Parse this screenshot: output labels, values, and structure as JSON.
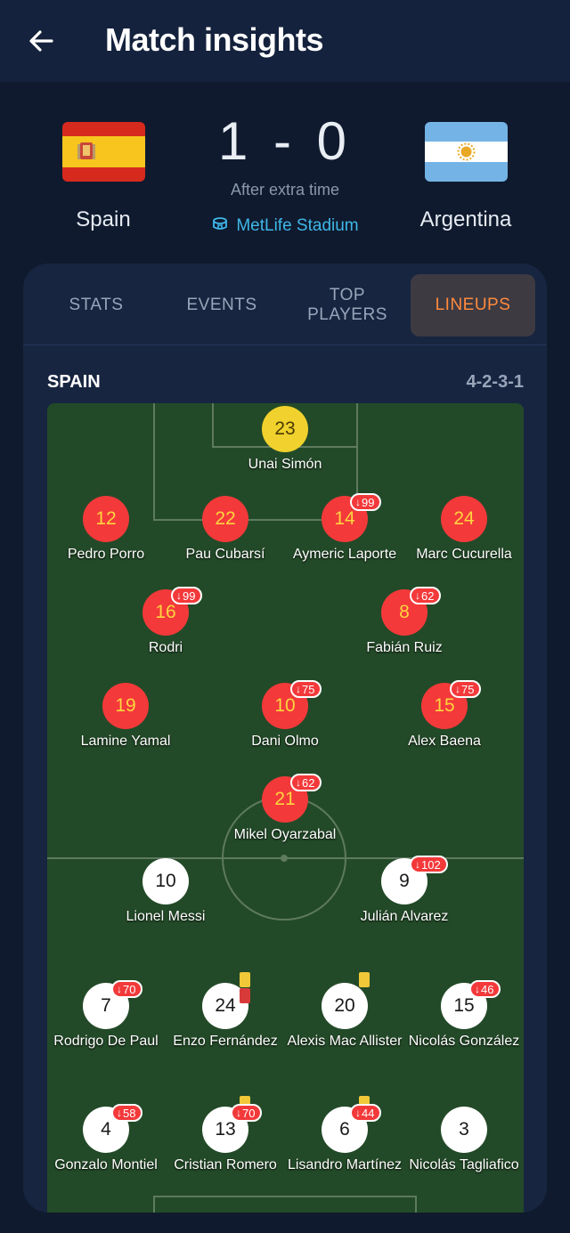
{
  "header": {
    "title": "Match insights",
    "back_icon": "arrow-left-icon"
  },
  "match": {
    "home": {
      "name": "Spain",
      "flag": "spain-flag"
    },
    "away": {
      "name": "Argentina",
      "flag": "argentina-flag"
    },
    "score": "1 - 0",
    "status": "After extra time",
    "venue": "MetLife Stadium",
    "venue_icon": "stadium-icon"
  },
  "tabs": [
    {
      "label": "STATS",
      "active": false
    },
    {
      "label": "EVENTS",
      "active": false
    },
    {
      "label": "TOP PLAYERS",
      "active": false
    },
    {
      "label": "LINEUPS",
      "active": true
    }
  ],
  "lineup": {
    "team": "SPAIN",
    "formation": "4-2-3-1",
    "home_players": [
      {
        "number": "23",
        "name": "Unai Simón",
        "kit": "gk"
      },
      {
        "number": "12",
        "name": "Pedro Porro",
        "kit": "red"
      },
      {
        "number": "22",
        "name": "Pau Cubarsí",
        "kit": "red"
      },
      {
        "number": "14",
        "name": "Aymeric Laporte",
        "kit": "red",
        "sub": "99"
      },
      {
        "number": "24",
        "name": "Marc Cucurella",
        "kit": "red"
      },
      {
        "number": "16",
        "name": "Rodri",
        "kit": "red",
        "sub": "99"
      },
      {
        "number": "8",
        "name": "Fabián Ruiz",
        "kit": "red",
        "sub": "62"
      },
      {
        "number": "19",
        "name": "Lamine Yamal",
        "kit": "red"
      },
      {
        "number": "10",
        "name": "Dani Olmo",
        "kit": "red",
        "sub": "75"
      },
      {
        "number": "15",
        "name": "Alex Baena",
        "kit": "red",
        "sub": "75"
      },
      {
        "number": "21",
        "name": "Mikel Oyarzabal",
        "kit": "red",
        "sub": "62"
      }
    ],
    "away_players": [
      {
        "number": "10",
        "name": "Lionel Messi",
        "kit": "white"
      },
      {
        "number": "9",
        "name": "Julián Alvarez",
        "kit": "white",
        "sub": "102"
      },
      {
        "number": "7",
        "name": "Rodrigo De Paul",
        "kit": "white",
        "sub": "70"
      },
      {
        "number": "24",
        "name": "Enzo Fernández",
        "kit": "white",
        "cards": "yellow-red"
      },
      {
        "number": "20",
        "name": "Alexis Mac Allister",
        "kit": "white",
        "cards": "yellow"
      },
      {
        "number": "15",
        "name": "Nicolás González",
        "kit": "white",
        "sub": "46"
      },
      {
        "number": "4",
        "name": "Gonzalo Montiel",
        "kit": "white",
        "sub": "58"
      },
      {
        "number": "13",
        "name": "Cristian Romero",
        "kit": "white",
        "sub": "70",
        "cards": "yellow"
      },
      {
        "number": "6",
        "name": "Lisandro Martínez",
        "kit": "white",
        "sub": "44",
        "cards": "yellow"
      },
      {
        "number": "3",
        "name": "Nicolás Tagliafico",
        "kit": "white"
      }
    ]
  },
  "colors": {
    "background": "#0f1a2e",
    "active_tab": "#ff8a3d",
    "pitch": "#234a28",
    "spain_kit": "#f3393a",
    "argentina_kit": "#ffffff",
    "sub_badge": "#f3393a",
    "yellow_card": "#f1c838",
    "red_card": "#d83a3a",
    "venue_link": "#3fb7e8"
  }
}
